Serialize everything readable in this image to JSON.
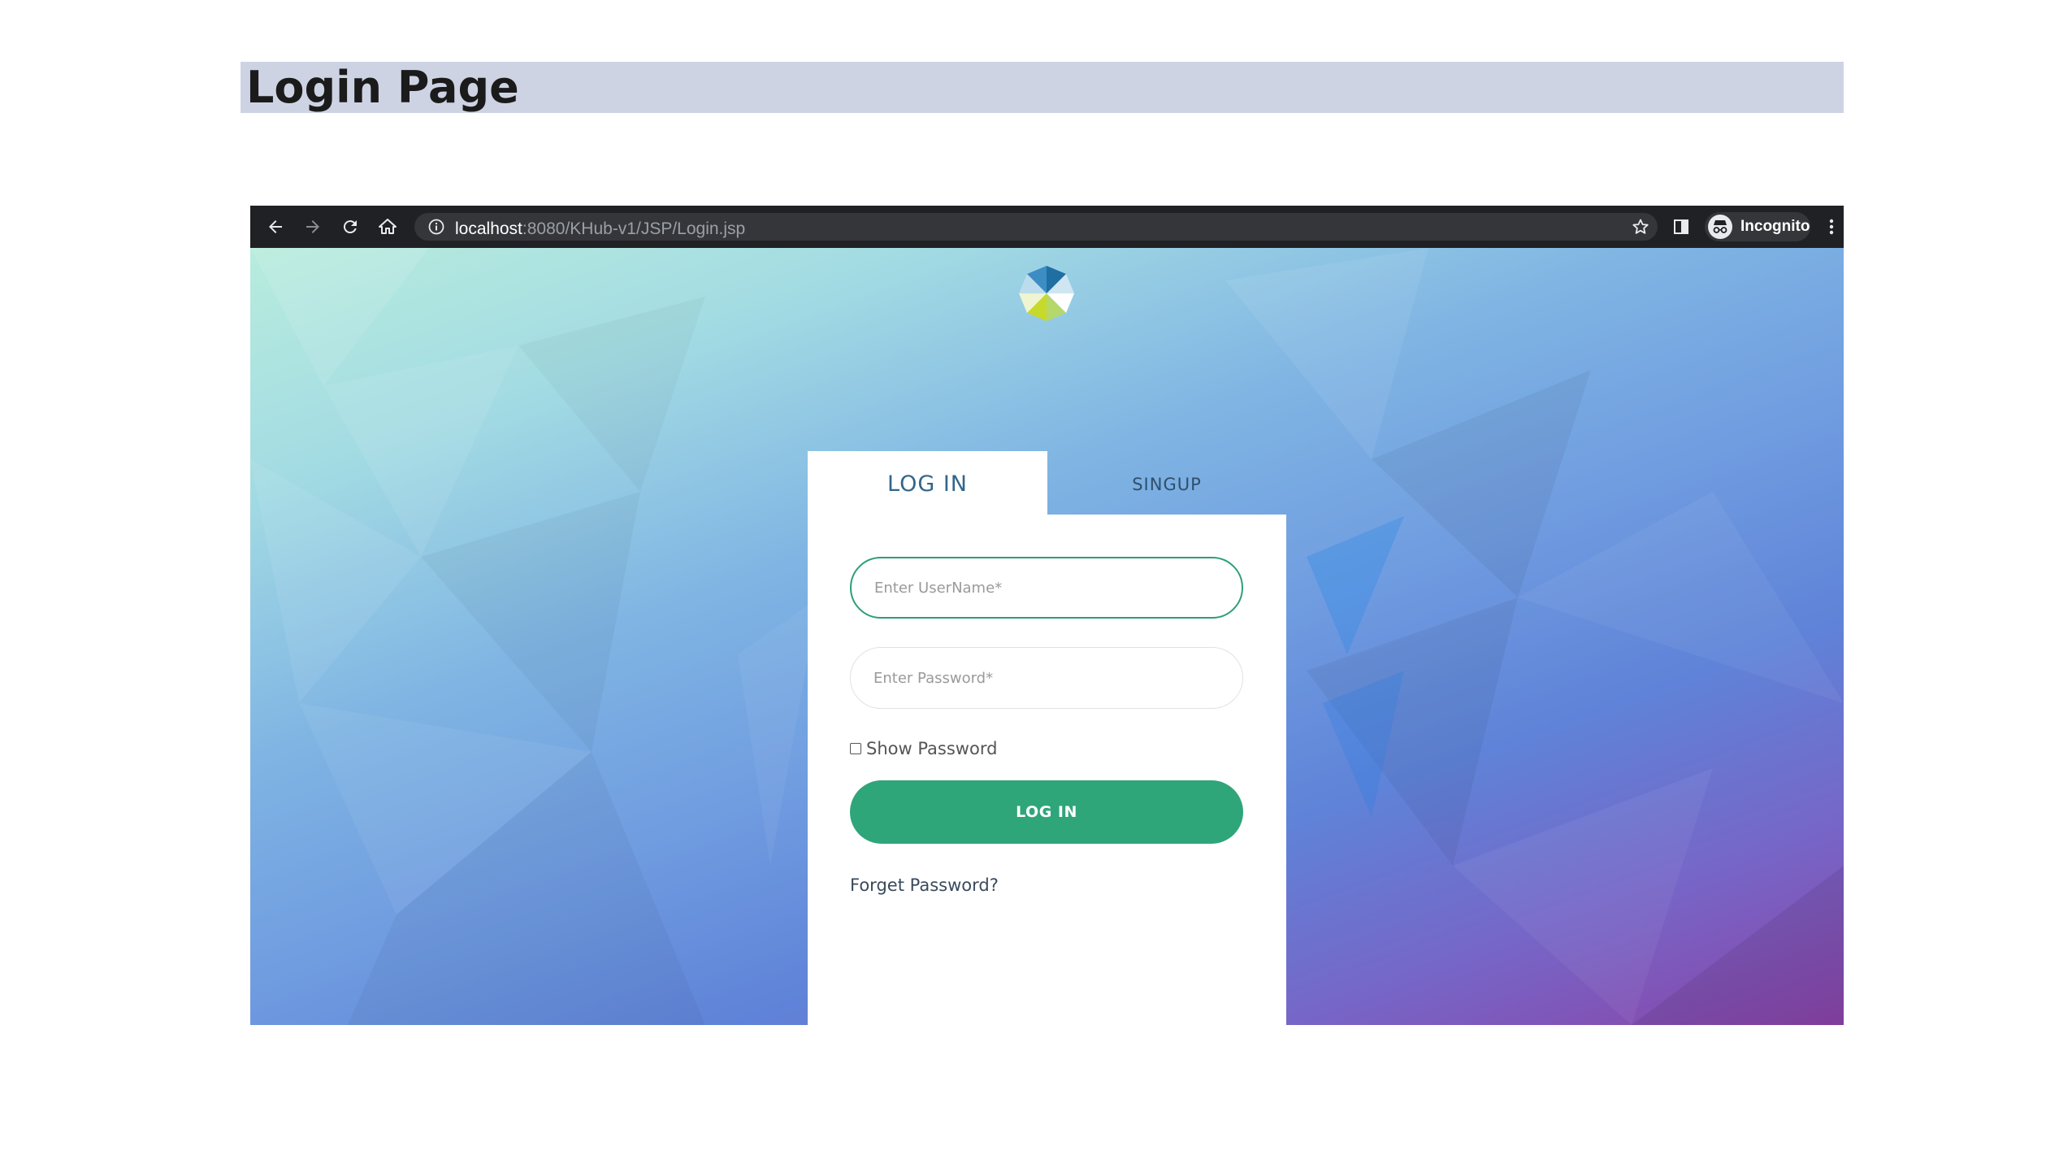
{
  "page": {
    "title": "Login Page"
  },
  "browser": {
    "url_host": "localhost",
    "url_path": ":8080/KHub-v1/JSP/Login.jsp",
    "profile_label": "Incognito"
  },
  "tabs": {
    "login_label": "LOG IN",
    "signup_label": "SINGUP"
  },
  "form": {
    "username_placeholder": "Enter UserName*",
    "password_placeholder": "Enter Password*",
    "username_value": "",
    "password_value": "",
    "show_password_label": "Show Password",
    "show_password_checked": false,
    "submit_label": "LOG IN",
    "forget_password_label": "Forget Password?"
  },
  "colors": {
    "accent_green": "#2fa57a",
    "heading_bar": "#ced3e4",
    "tab_active_text": "#33658a",
    "toolbar_bg": "#202124"
  },
  "icons": {
    "back": "arrow-left-icon",
    "forward": "arrow-right-icon",
    "reload": "reload-icon",
    "home": "home-icon",
    "site_info": "info-icon",
    "bookmark": "star-icon",
    "side_panel": "side-panel-icon",
    "incognito": "incognito-icon",
    "menu": "kebab-menu-icon",
    "logo": "pinwheel-logo"
  }
}
